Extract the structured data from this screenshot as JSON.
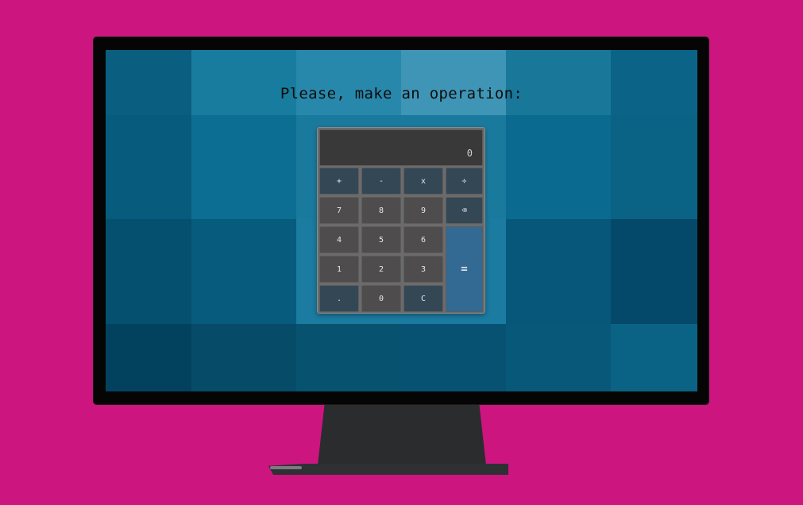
{
  "prompt": "Please, make an operation:",
  "display": {
    "value": "0"
  },
  "keys": {
    "add": "+",
    "subtract": "-",
    "multiply": "x",
    "divide": "÷",
    "seven": "7",
    "eight": "8",
    "nine": "9",
    "backspace": "⌫",
    "four": "4",
    "five": "5",
    "six": "6",
    "one": "1",
    "two": "2",
    "three": "3",
    "equals": "=",
    "decimal": ".",
    "zero": "0",
    "clear": "C"
  },
  "colors": {
    "background": "#cd1580",
    "screen": "#075a7a",
    "number_key": "#4e4c4c",
    "operator_key": "#344755",
    "equals_key": "#336a93",
    "display": "#3a3939"
  }
}
